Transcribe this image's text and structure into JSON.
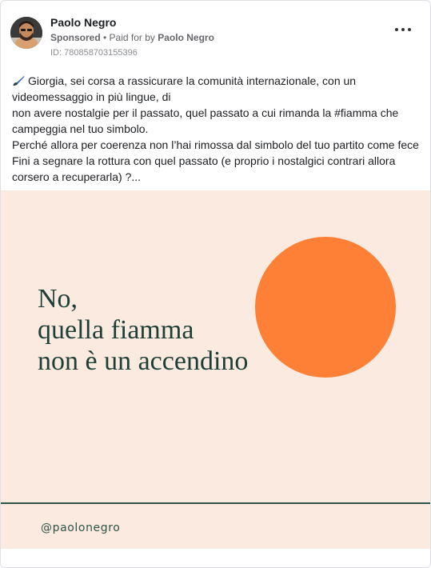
{
  "post": {
    "author": "Paolo Negro",
    "sponsored_label": "Sponsored",
    "paid_for_prefix": " • Paid for by ",
    "paid_for_name": "Paolo Negro",
    "ad_id": "ID: 780858703155396",
    "more_icon": "more-dots-icon",
    "body_lines": [
      "Giorgia, sei corsa a rassicurare la comunità internazionale, con un",
      "videomessaggio in più lingue, di",
      "non avere nostalgie per il passato, quel passato a cui rimanda la #fiamma che",
      "campeggia nel tuo simbolo.",
      "Perché allora per coerenza non l’hai rimossa dal simbolo del tuo partito come fece",
      "Fini a segnare la rottura con quel passato (e proprio i nostalgici contrari allora",
      "corsero a recuperarla) ?..."
    ],
    "body_icon": "paintbrush-icon"
  },
  "creative": {
    "headline_lines": [
      "No,",
      "quella fiamma",
      "non è un accendino"
    ],
    "handle": "@paolonegro",
    "colors": {
      "background": "#fbeadf",
      "circle": "#fe7f36",
      "text": "#1e3f37"
    }
  }
}
